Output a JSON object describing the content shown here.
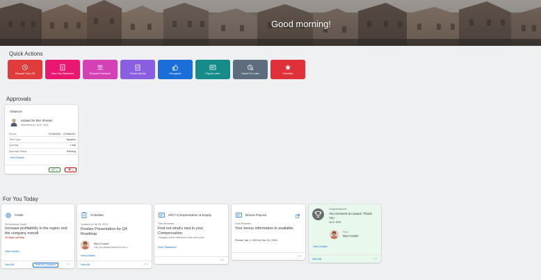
{
  "header": {
    "greeting": "Good morning!"
  },
  "quick_actions": {
    "title": "Quick Actions",
    "items": [
      {
        "label": "Request Time Off",
        "color": "#e03c3c",
        "icon": "time-off-icon"
      },
      {
        "label": "View Pay Statement",
        "color": "#e8176f",
        "icon": "pay-statement-icon"
      },
      {
        "label": "Request Feedback",
        "color": "#d440b5",
        "icon": "feedback-icon"
      },
      {
        "label": "Create Activity",
        "color": "#8a5ee0",
        "icon": "activity-icon"
      },
      {
        "label": "Recognize",
        "color": "#1b6ed8",
        "icon": "thumbs-up-icon"
      },
      {
        "label": "Payroll Letter",
        "color": "#158c89",
        "icon": "letter-icon"
      },
      {
        "label": "Saved For Later",
        "color": "#5d6d7e",
        "icon": "saved-icon"
      },
      {
        "label": "Favorites",
        "color": "#e0313a",
        "icon": "star-icon"
      }
    ]
  },
  "approvals": {
    "title": "Approvals",
    "card": {
      "type": "Absence",
      "initiated": "Initiated for Ben Sherwin",
      "submitted": "Submitted on Jul 8, 2021",
      "rows": [
        {
          "key": "Period",
          "value": "07/06/2021 - 07/08/2021"
        },
        {
          "key": "Time Type",
          "value": "Vacation"
        },
        {
          "key": "Quantity",
          "value": "1 day"
        },
        {
          "key": "Approval Status",
          "value": "Pending"
        }
      ],
      "view_details": "View Details",
      "approve_icon": "checkmark-icon",
      "reject_icon": "close-icon"
    }
  },
  "for_you_today": {
    "title": "For You Today",
    "goals": {
      "title": "Goals",
      "category": "Performance Goals",
      "text": "Increase profitability in the region and the company overall",
      "status": "10 days overdue",
      "status_color": "#bb0000",
      "view_details": "View Details",
      "view_all": "View All",
      "mark_complete": "Mark as Complete"
    },
    "activities": {
      "title": "Activities",
      "updated": "Updated on Jul 28, 2021",
      "text": "Finalize Presentation for Q4 Roadmap",
      "person": "Mya Cooper",
      "note": "Can you please present in our n...",
      "view_details": "View Details",
      "view_all": "View All"
    },
    "compensation": {
      "title": "2017 Compensation & Equity",
      "category": "Total Rewards",
      "text": "Find out what's new in your Compensation.",
      "note": "Changes will be effective in the next cycle.",
      "view_statement": "View Statement"
    },
    "bonus": {
      "title": "Bonus Payout",
      "category": "Total Rewards",
      "text": "Your bonus information is available.",
      "period": "Period: Jan 1, 2019 to Dec 31, 2019"
    },
    "award": {
      "congrats": "Congratulations!",
      "text": "You received an award. Thank You",
      "date": "Jul 9, 2021",
      "from_label": "From",
      "person": "Mya Cooper",
      "view_details": "View Details",
      "view_all": "View All"
    }
  }
}
